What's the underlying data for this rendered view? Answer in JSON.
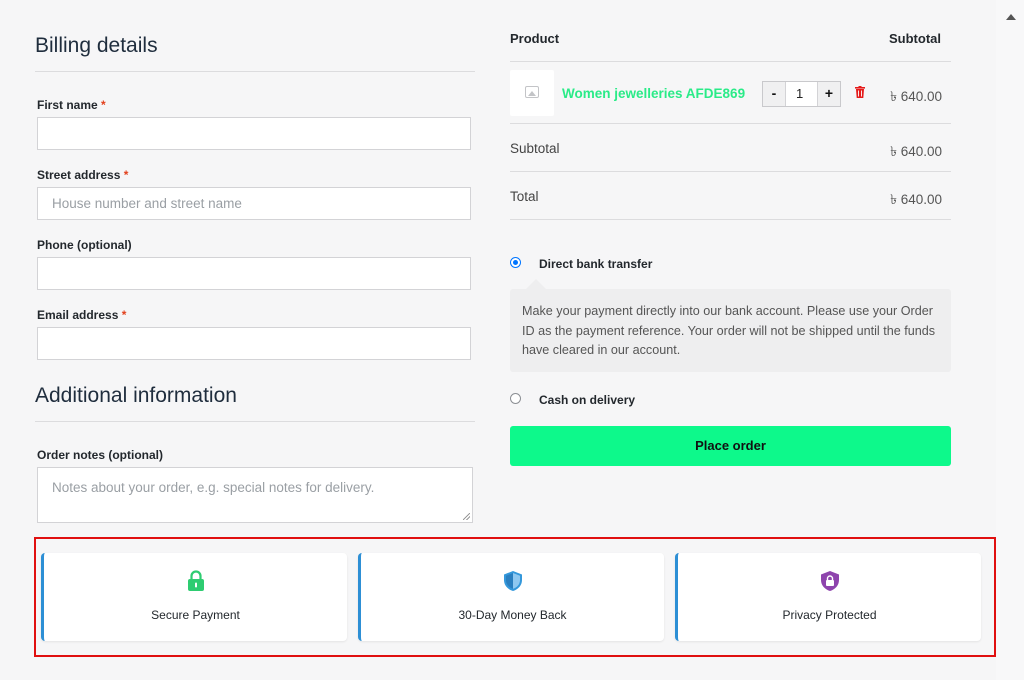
{
  "billing": {
    "title": "Billing details",
    "first_name_label": "First name",
    "street_label": "Street address",
    "street_placeholder": "House number and street name",
    "phone_label": "Phone (optional)",
    "email_label": "Email address",
    "required_mark": "*"
  },
  "additional": {
    "title": "Additional information",
    "notes_label": "Order notes (optional)",
    "notes_placeholder": "Notes about your order, e.g. special notes for delivery."
  },
  "order": {
    "col_product": "Product",
    "col_subtotal": "Subtotal",
    "item": {
      "name": "Women jewelleries AFDE869",
      "qty": "1",
      "minus": "-",
      "plus": "+",
      "price": "৳ 640.00"
    },
    "subtotal_label": "Subtotal",
    "subtotal_value": "৳ 640.00",
    "total_label": "Total",
    "total_value": "৳ 640.00"
  },
  "payment": {
    "bank_label": "Direct bank transfer",
    "bank_desc": "Make your payment directly into our bank account. Please use your Order ID as the payment reference. Your order will not be shipped until the funds have cleared in our account.",
    "cod_label": "Cash on delivery",
    "selected": "Direct bank transfer",
    "place_order": "Place order"
  },
  "badges": [
    {
      "label": "Secure Payment",
      "icon": "lock-icon",
      "color": "#2ecc71"
    },
    {
      "label": "30-Day Money Back",
      "icon": "shield-icon",
      "color": "#3498db"
    },
    {
      "label": "Privacy Protected",
      "icon": "shield-lock-icon",
      "color": "#8e44ad"
    }
  ],
  "colors": {
    "accent": "#0df98b",
    "product_link": "#2aeb88",
    "highlight_border": "#e01010",
    "required": "#e2401c"
  }
}
